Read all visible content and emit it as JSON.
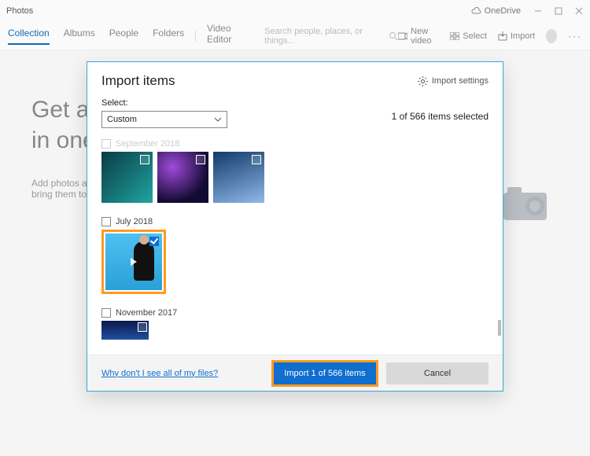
{
  "titlebar": {
    "app_name": "Photos",
    "onedrive": "OneDrive"
  },
  "nav": {
    "tabs": {
      "collection": "Collection",
      "albums": "Albums",
      "people": "People",
      "folders": "Folders",
      "video_editor": "Video Editor"
    },
    "search_placeholder": "Search people, places, or things...",
    "actions": {
      "new_video": "New video",
      "select": "Select",
      "import": "Import"
    }
  },
  "bg": {
    "hero_line1": "Get a",
    "hero_line2": "in one",
    "hero_sub": "Add photos and videos from your devices and bring them together."
  },
  "modal": {
    "title": "Import items",
    "settings_label": "Import settings",
    "select_label": "Select:",
    "dropdown_value": "Custom",
    "count_text": "1 of 566 items selected",
    "months": {
      "sep2018": "September 2018",
      "jul2018": "July 2018",
      "nov2017": "November 2017"
    },
    "footer_link": "Why don't I see all of my files?",
    "import_btn": "Import 1 of 566 items",
    "cancel_btn": "Cancel"
  }
}
